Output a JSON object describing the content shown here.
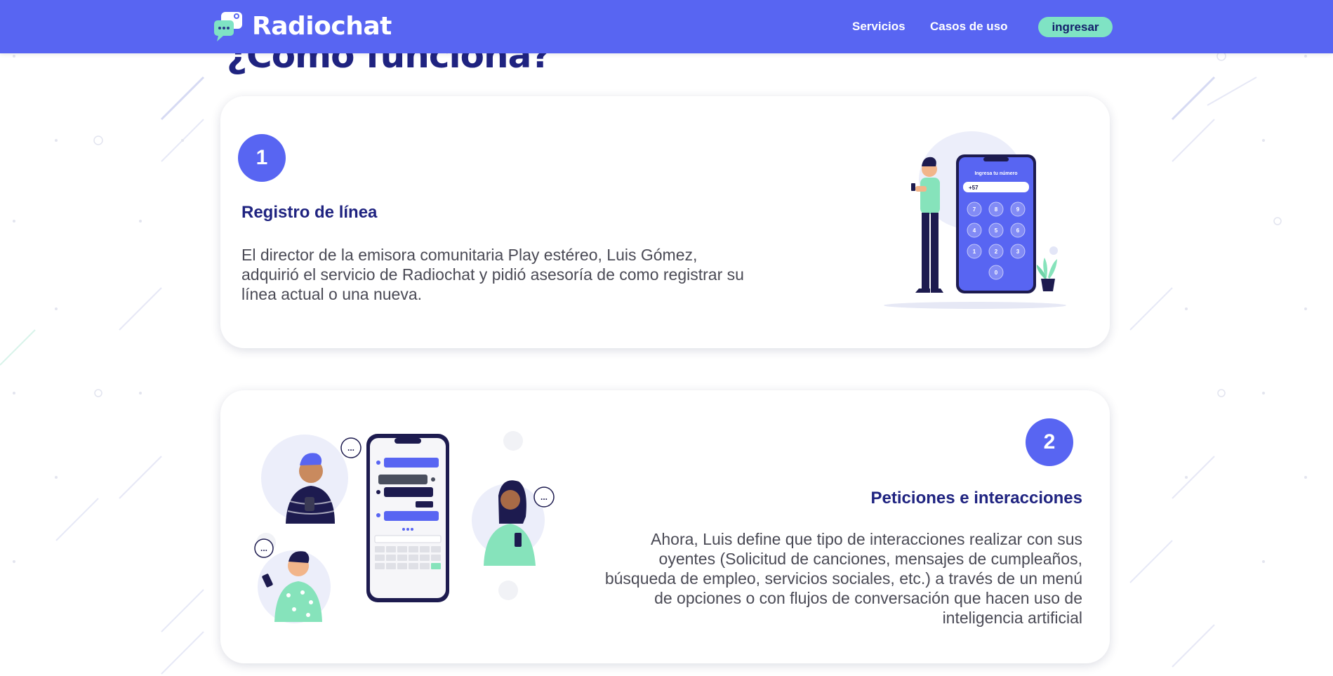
{
  "header": {
    "brand_name": "Radiochat",
    "logo_icon": "chat-bubble-logo-icon",
    "nav": [
      {
        "label": "Servicios"
      },
      {
        "label": "Casos de uso"
      }
    ],
    "login_label": "ingresar",
    "colors": {
      "bar": "#5865f2",
      "button": "#7fe3c4",
      "button_text": "#14206b"
    }
  },
  "section": {
    "title": "¿Como funciona?"
  },
  "steps": [
    {
      "number": "1",
      "title": "Registro de línea",
      "text": "El director de la emisora comunitaria Play estéreo, Luis Gómez, adquirió el servicio de Radiochat y pidió asesoría de como registrar su línea actual o una nueva.",
      "illustration": {
        "phone_title": "Ingresa tu número",
        "phone_prefix": "+57",
        "keys": [
          "7",
          "8",
          "9",
          "4",
          "5",
          "6",
          "1",
          "2",
          "3",
          "0"
        ]
      }
    },
    {
      "number": "2",
      "title": "Peticiones e interacciones",
      "text": "Ahora, Luis define que tipo de interacciones realizar con sus oyentes (Solicitud de canciones, mensajes de cumpleaños, búsqueda de empleo, servicios sociales, etc.) a través de un menú de opciones o con flujos de conversación que hacen uso de inteligencia artificial",
      "illustration": {
        "bubble_text": "..."
      }
    }
  ],
  "theme": {
    "accent": "#5865f2",
    "heading": "#1f2380",
    "body_text": "#4a4a55",
    "mint": "#7fe3c4"
  }
}
